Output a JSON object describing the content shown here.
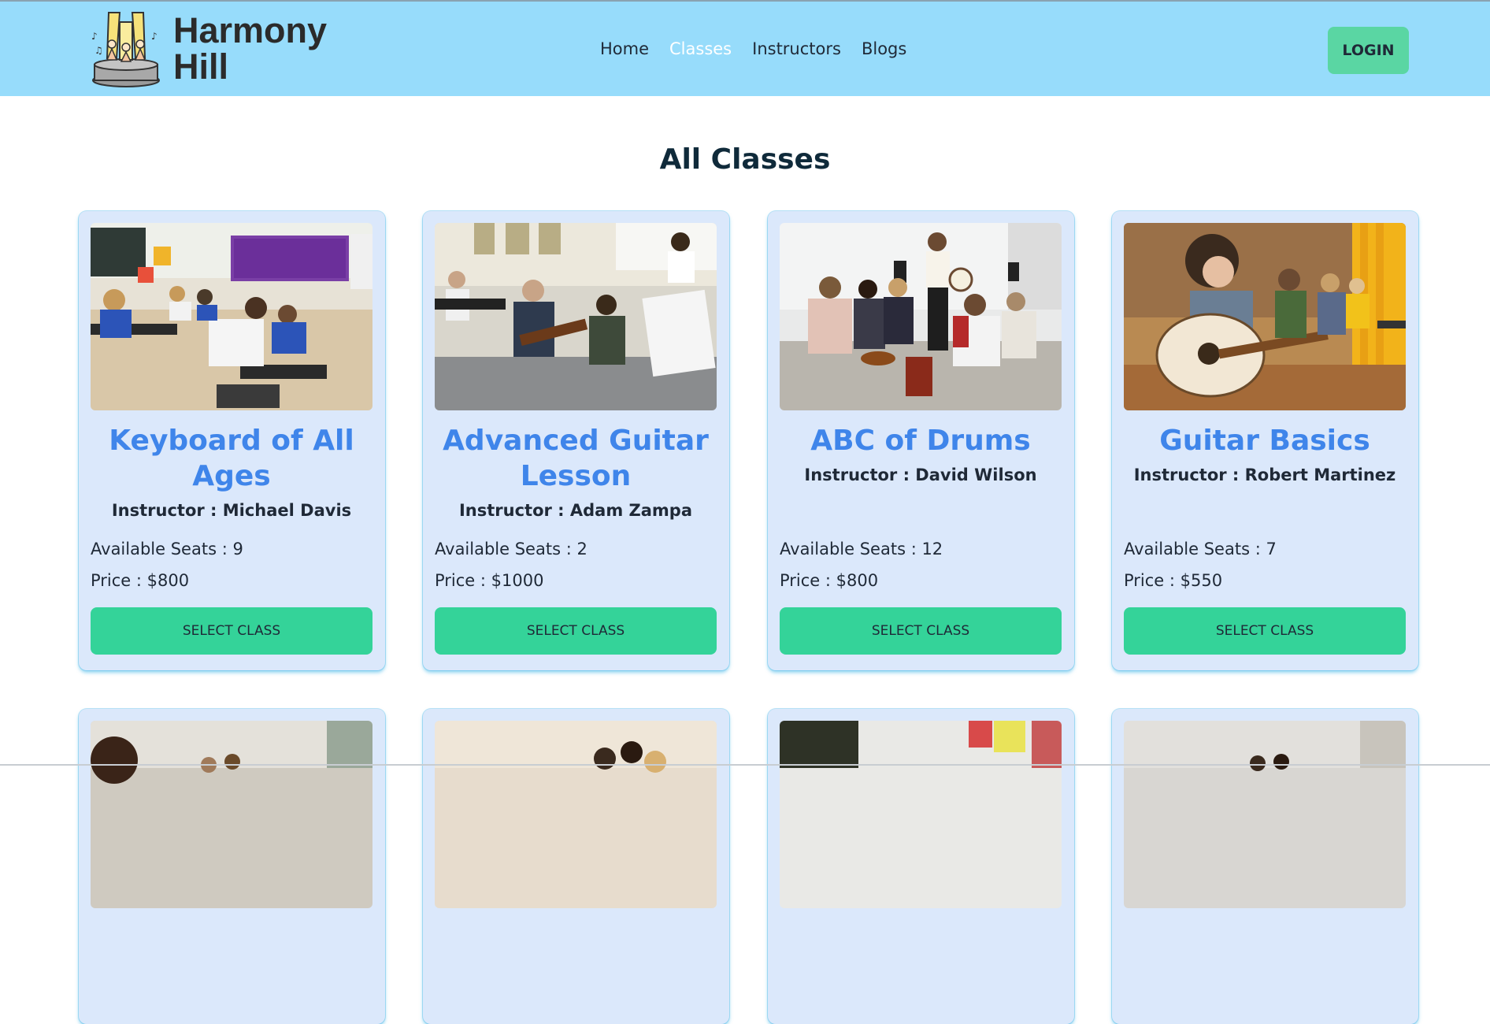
{
  "brand": {
    "name_line1": "Harmony",
    "name_line2": "Hill",
    "logo_icon": "singers-stage-logo"
  },
  "nav": {
    "links": [
      {
        "label": "Home",
        "active": false
      },
      {
        "label": "Classes",
        "active": true
      },
      {
        "label": "Instructors",
        "active": false
      },
      {
        "label": "Blogs",
        "active": false
      }
    ],
    "login_label": "LOGIN"
  },
  "page": {
    "title": "All Classes"
  },
  "classes": [
    {
      "title": "Keyboard of All Ages",
      "instructor": "Instructor : Michael Davis",
      "seats": "Available Seats : 9",
      "price": "Price : $800",
      "button": "SELECT CLASS"
    },
    {
      "title": "Advanced Guitar Lesson",
      "instructor": "Instructor : Adam Zampa",
      "seats": "Available Seats : 2",
      "price": "Price : $1000",
      "button": "SELECT CLASS"
    },
    {
      "title": "ABC of Drums",
      "instructor": "Instructor : David Wilson",
      "seats": "Available Seats : 12",
      "price": "Price : $800",
      "button": "SELECT CLASS"
    },
    {
      "title": "Guitar Basics",
      "instructor": "Instructor : Robert Martinez",
      "seats": "Available Seats : 7",
      "price": "Price : $550",
      "button": "SELECT CLASS"
    }
  ],
  "colors": {
    "navbar": "#97dcfb",
    "active_link": "#ffffff",
    "card_bg": "#dbe8fb",
    "title_blue": "#3f85ea",
    "button_green": "#34d399",
    "login_green": "#5ad6a3"
  }
}
